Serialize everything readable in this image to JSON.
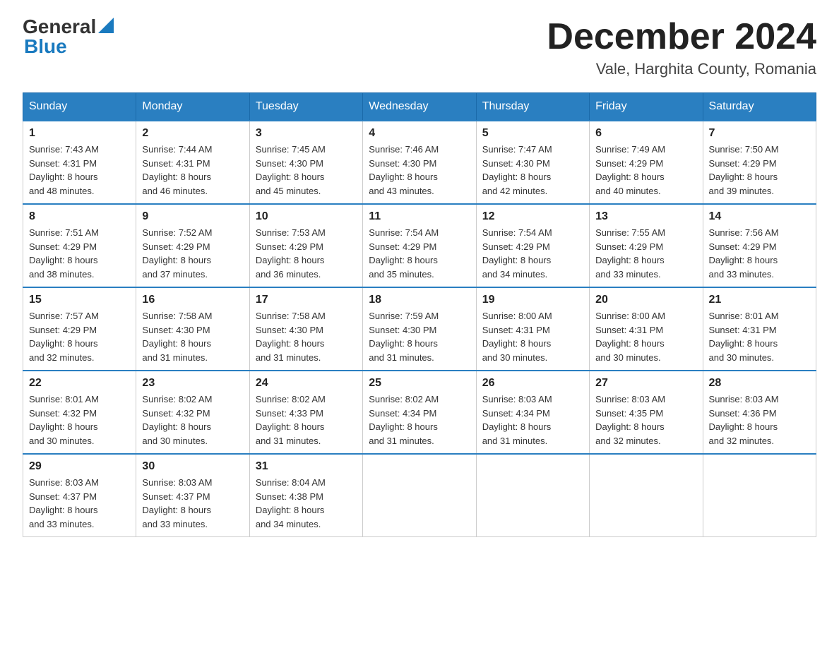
{
  "header": {
    "logo_general": "General",
    "logo_blue": "Blue",
    "month_title": "December 2024",
    "location": "Vale, Harghita County, Romania"
  },
  "days_of_week": [
    "Sunday",
    "Monday",
    "Tuesday",
    "Wednesday",
    "Thursday",
    "Friday",
    "Saturday"
  ],
  "weeks": [
    [
      {
        "day": "1",
        "sunrise": "7:43 AM",
        "sunset": "4:31 PM",
        "daylight": "8 hours and 48 minutes."
      },
      {
        "day": "2",
        "sunrise": "7:44 AM",
        "sunset": "4:31 PM",
        "daylight": "8 hours and 46 minutes."
      },
      {
        "day": "3",
        "sunrise": "7:45 AM",
        "sunset": "4:30 PM",
        "daylight": "8 hours and 45 minutes."
      },
      {
        "day": "4",
        "sunrise": "7:46 AM",
        "sunset": "4:30 PM",
        "daylight": "8 hours and 43 minutes."
      },
      {
        "day": "5",
        "sunrise": "7:47 AM",
        "sunset": "4:30 PM",
        "daylight": "8 hours and 42 minutes."
      },
      {
        "day": "6",
        "sunrise": "7:49 AM",
        "sunset": "4:29 PM",
        "daylight": "8 hours and 40 minutes."
      },
      {
        "day": "7",
        "sunrise": "7:50 AM",
        "sunset": "4:29 PM",
        "daylight": "8 hours and 39 minutes."
      }
    ],
    [
      {
        "day": "8",
        "sunrise": "7:51 AM",
        "sunset": "4:29 PM",
        "daylight": "8 hours and 38 minutes."
      },
      {
        "day": "9",
        "sunrise": "7:52 AM",
        "sunset": "4:29 PM",
        "daylight": "8 hours and 37 minutes."
      },
      {
        "day": "10",
        "sunrise": "7:53 AM",
        "sunset": "4:29 PM",
        "daylight": "8 hours and 36 minutes."
      },
      {
        "day": "11",
        "sunrise": "7:54 AM",
        "sunset": "4:29 PM",
        "daylight": "8 hours and 35 minutes."
      },
      {
        "day": "12",
        "sunrise": "7:54 AM",
        "sunset": "4:29 PM",
        "daylight": "8 hours and 34 minutes."
      },
      {
        "day": "13",
        "sunrise": "7:55 AM",
        "sunset": "4:29 PM",
        "daylight": "8 hours and 33 minutes."
      },
      {
        "day": "14",
        "sunrise": "7:56 AM",
        "sunset": "4:29 PM",
        "daylight": "8 hours and 33 minutes."
      }
    ],
    [
      {
        "day": "15",
        "sunrise": "7:57 AM",
        "sunset": "4:29 PM",
        "daylight": "8 hours and 32 minutes."
      },
      {
        "day": "16",
        "sunrise": "7:58 AM",
        "sunset": "4:30 PM",
        "daylight": "8 hours and 31 minutes."
      },
      {
        "day": "17",
        "sunrise": "7:58 AM",
        "sunset": "4:30 PM",
        "daylight": "8 hours and 31 minutes."
      },
      {
        "day": "18",
        "sunrise": "7:59 AM",
        "sunset": "4:30 PM",
        "daylight": "8 hours and 31 minutes."
      },
      {
        "day": "19",
        "sunrise": "8:00 AM",
        "sunset": "4:31 PM",
        "daylight": "8 hours and 30 minutes."
      },
      {
        "day": "20",
        "sunrise": "8:00 AM",
        "sunset": "4:31 PM",
        "daylight": "8 hours and 30 minutes."
      },
      {
        "day": "21",
        "sunrise": "8:01 AM",
        "sunset": "4:31 PM",
        "daylight": "8 hours and 30 minutes."
      }
    ],
    [
      {
        "day": "22",
        "sunrise": "8:01 AM",
        "sunset": "4:32 PM",
        "daylight": "8 hours and 30 minutes."
      },
      {
        "day": "23",
        "sunrise": "8:02 AM",
        "sunset": "4:32 PM",
        "daylight": "8 hours and 30 minutes."
      },
      {
        "day": "24",
        "sunrise": "8:02 AM",
        "sunset": "4:33 PM",
        "daylight": "8 hours and 31 minutes."
      },
      {
        "day": "25",
        "sunrise": "8:02 AM",
        "sunset": "4:34 PM",
        "daylight": "8 hours and 31 minutes."
      },
      {
        "day": "26",
        "sunrise": "8:03 AM",
        "sunset": "4:34 PM",
        "daylight": "8 hours and 31 minutes."
      },
      {
        "day": "27",
        "sunrise": "8:03 AM",
        "sunset": "4:35 PM",
        "daylight": "8 hours and 32 minutes."
      },
      {
        "day": "28",
        "sunrise": "8:03 AM",
        "sunset": "4:36 PM",
        "daylight": "8 hours and 32 minutes."
      }
    ],
    [
      {
        "day": "29",
        "sunrise": "8:03 AM",
        "sunset": "4:37 PM",
        "daylight": "8 hours and 33 minutes."
      },
      {
        "day": "30",
        "sunrise": "8:03 AM",
        "sunset": "4:37 PM",
        "daylight": "8 hours and 33 minutes."
      },
      {
        "day": "31",
        "sunrise": "8:04 AM",
        "sunset": "4:38 PM",
        "daylight": "8 hours and 34 minutes."
      },
      null,
      null,
      null,
      null
    ]
  ],
  "labels": {
    "sunrise_prefix": "Sunrise: ",
    "sunset_prefix": "Sunset: ",
    "daylight_prefix": "Daylight: "
  }
}
